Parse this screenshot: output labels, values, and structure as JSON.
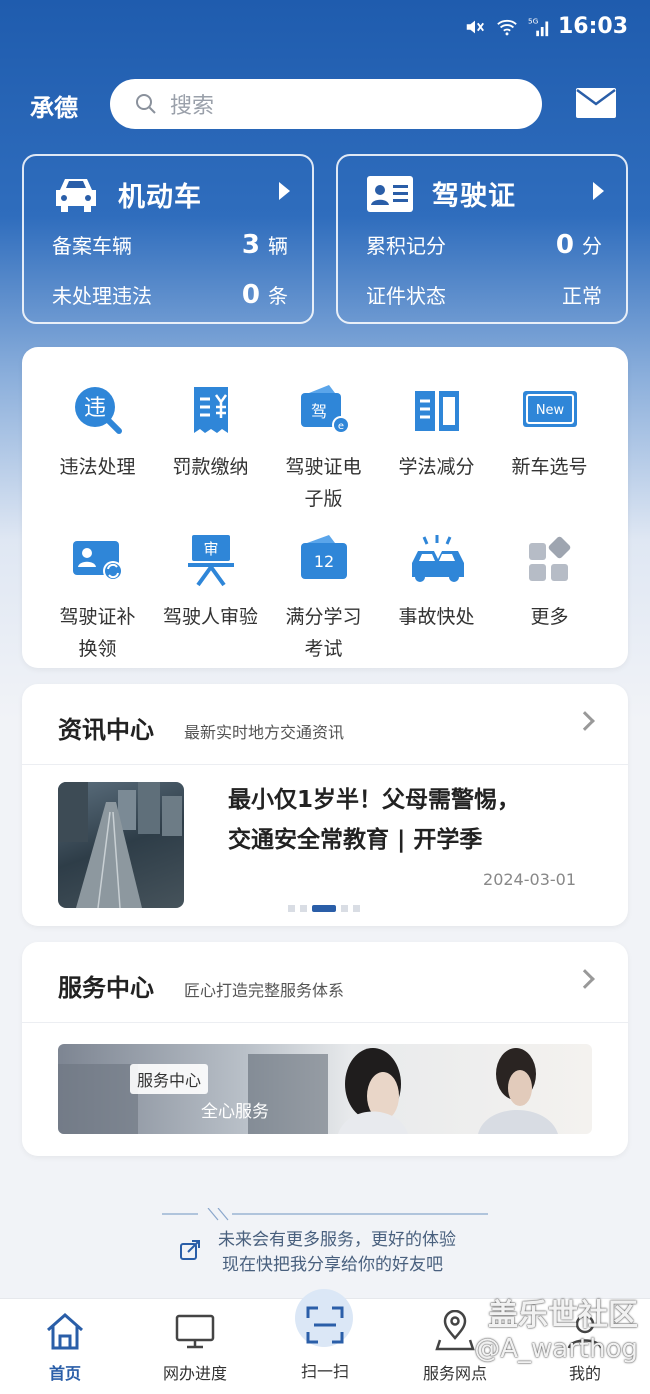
{
  "status_bar": {
    "time": "16:03",
    "network": "5G"
  },
  "header": {
    "city": "承德",
    "search_placeholder": "搜索"
  },
  "vehicle_card": {
    "title": "机动车",
    "rows": [
      {
        "label": "备案车辆",
        "value": "3",
        "unit": "辆"
      },
      {
        "label": "未处理违法",
        "value": "0",
        "unit": "条"
      }
    ]
  },
  "license_card": {
    "title": "驾驶证",
    "rows": [
      {
        "label": "累积记分",
        "value": "0",
        "unit": "分"
      },
      {
        "label": "证件状态",
        "value": "正常",
        "unit": ""
      }
    ]
  },
  "services": [
    {
      "label": "违法处理",
      "icon": "violation-icon"
    },
    {
      "label": "罚款缴纳",
      "icon": "fine-payment-icon"
    },
    {
      "label": "驾驶证电子版",
      "label_l1": "驾驶证电",
      "label_l2": "子版",
      "icon": "e-license-icon"
    },
    {
      "label": "学法减分",
      "icon": "study-book-icon"
    },
    {
      "label": "新车选号",
      "icon": "new-plate-icon",
      "badge": "New"
    },
    {
      "label": "驾驶证补换领",
      "label_l1": "驾驶证补",
      "label_l2": "换领",
      "icon": "license-replace-icon"
    },
    {
      "label": "驾驶人审验",
      "icon": "driver-review-icon",
      "badge": "审"
    },
    {
      "label": "满分学习考试",
      "label_l1": "满分学习",
      "label_l2": "考试",
      "icon": "full-score-study-icon",
      "badge": "12"
    },
    {
      "label": "事故快处",
      "icon": "accident-icon"
    },
    {
      "label": "更多",
      "icon": "more-grid-icon"
    }
  ],
  "news_section": {
    "title": "资讯中心",
    "subtitle": "最新实时地方交通资讯",
    "article": {
      "title": "最小仅1岁半！父母需警惕，交通安全常教育 | 开学季",
      "title_l1": "最小仅1岁半！父母需警惕，",
      "title_l2": "交通安全常教育 | 开学季",
      "date": "2024-03-01"
    },
    "carousel": {
      "count": 5,
      "active": 2
    }
  },
  "service_section": {
    "title": "服务中心",
    "subtitle": "匠心打造完整服务体系",
    "banner_tag": "服务中心",
    "banner_text": "全心服务"
  },
  "promo": {
    "line1": "未来会有更多服务，更好的体验",
    "line2": "现在快把我分享给你的好友吧"
  },
  "tabs": [
    {
      "label": "首页",
      "icon": "home-icon",
      "active": true
    },
    {
      "label": "网办进度",
      "icon": "monitor-icon",
      "active": false
    },
    {
      "label": "扫一扫",
      "icon": "scan-icon",
      "active": false
    },
    {
      "label": "服务网点",
      "icon": "location-pin-icon",
      "active": false
    },
    {
      "label": "我的",
      "icon": "user-icon",
      "active": false
    }
  ],
  "watermark": {
    "line1": "盖乐世社区",
    "line2": "@A_warthog"
  },
  "colors": {
    "brand_blue": "#2a5ea8",
    "header_blue": "#1f5cae",
    "icon_blue": "#2f86d8"
  }
}
